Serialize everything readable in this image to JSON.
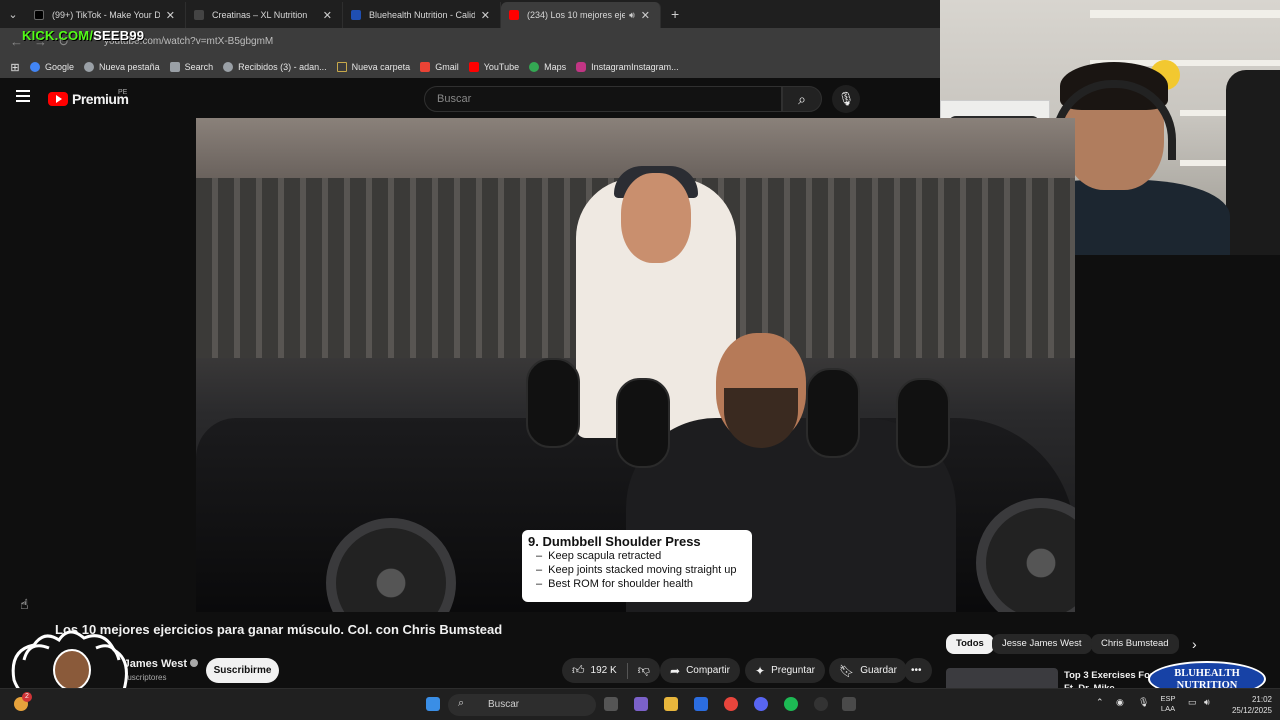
{
  "browser": {
    "tabs": [
      {
        "title": "(99+) TikTok - Make Your Day",
        "color": "#000000"
      },
      {
        "title": "Creatinas – XL Nutrition",
        "color": "#444444"
      },
      {
        "title": "Bluehealth Nutrition - Calidad G",
        "color": "#1f4fb3"
      },
      {
        "title": "(234) Los 10 mejores ejercic",
        "color": "#ff0000",
        "active": true
      }
    ],
    "url": "youtube.com/watch?v=mtX-B5gbgmM",
    "kick_handle_a": "KICK.COM/",
    "kick_handle_b": "SEEB99"
  },
  "bookmarks": [
    {
      "label": "Google",
      "color": "#4285f4"
    },
    {
      "label": "Nueva pestaña",
      "color": "#9aa0a6"
    },
    {
      "label": "Search",
      "color": "#9aa0a6"
    },
    {
      "label": "Recibidos (3) - adan...",
      "color": "#9aa0a6"
    },
    {
      "label": "Nueva carpeta",
      "color": "#c8a94a"
    },
    {
      "label": "Gmail",
      "color": "#ea4335"
    },
    {
      "label": "YouTube",
      "color": "#ff0000"
    },
    {
      "label": "Maps",
      "color": "#34a853"
    },
    {
      "label": "InstagramInstagram...",
      "color": "#c13584"
    }
  ],
  "youtube": {
    "logo_text": "Premium",
    "region": "PE",
    "search_placeholder": "Buscar"
  },
  "video": {
    "caption_title": "9. Dumbbell Shoulder Press",
    "caption_points": [
      "Keep scapula retracted",
      "Keep joints stacked moving straight up",
      "Best ROM for shoulder health"
    ],
    "title": "Los 10 mejores ejercicios para ganar músculo. Col. con Chris Bumstead",
    "channel": "Jesse James West",
    "subscribers": "3,1 M de suscriptores",
    "subscribe_label": "Suscribirme",
    "likes": "192 K",
    "share_label": "Compartir",
    "ask_label": "Preguntar",
    "save_label": "Guardar"
  },
  "sidebar_chips": [
    "Todos",
    "Jesse James West",
    "Chris Bumstead"
  ],
  "recommendation": {
    "title": "Top 3 Exercises For Músculo - Ft. Dr. Mike"
  },
  "sponsor": {
    "line1": "BLUHEALTH",
    "line2": "NUTRITION"
  },
  "taskbar": {
    "search_placeholder": "Buscar",
    "lang_top": "ESP",
    "lang_bottom": "LAA",
    "time": "21:02",
    "date": "25/12/2025",
    "notif_count": "2"
  }
}
